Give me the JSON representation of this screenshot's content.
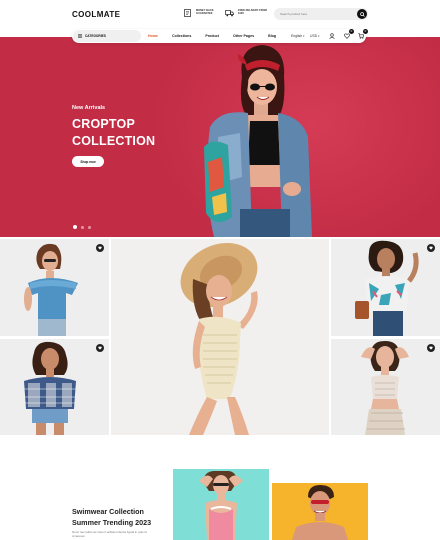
{
  "brand": {
    "logo_text": "COOLMATE"
  },
  "header": {
    "features": [
      {
        "icon": "receipt-icon",
        "text": "Money back\nguarantee"
      },
      {
        "icon": "truck-icon",
        "text": "Free delivery from\n$100"
      }
    ],
    "search": {
      "placeholder": "Search product here",
      "icon": "search-icon"
    }
  },
  "nav": {
    "categories_label": "CATEGORIES",
    "menu": [
      {
        "label": "Home",
        "active": true
      },
      {
        "label": "Collections",
        "active": false
      },
      {
        "label": "Product",
        "active": false
      },
      {
        "label": "Other Pages",
        "active": false
      },
      {
        "label": "Blog",
        "active": false
      }
    ],
    "language": "English",
    "currency": "USD",
    "wishlist_count": "0",
    "cart_count": "0"
  },
  "hero": {
    "subtitle": "New Arrivals",
    "title": "CROPTOP\nCOLLECTION",
    "button_label": "Shop now",
    "slide_count": 3,
    "active_slide": 1
  },
  "colors": {
    "accent": "#e0582a",
    "hero_bg": "#c22c45",
    "dark": "#111111"
  },
  "promo": {
    "title": "Swimwear Collection\nSummer Trending 2023",
    "description": "Nunc nec tellus ac risus fi acilisis lobortis ligula in quis id ut laoreet."
  }
}
